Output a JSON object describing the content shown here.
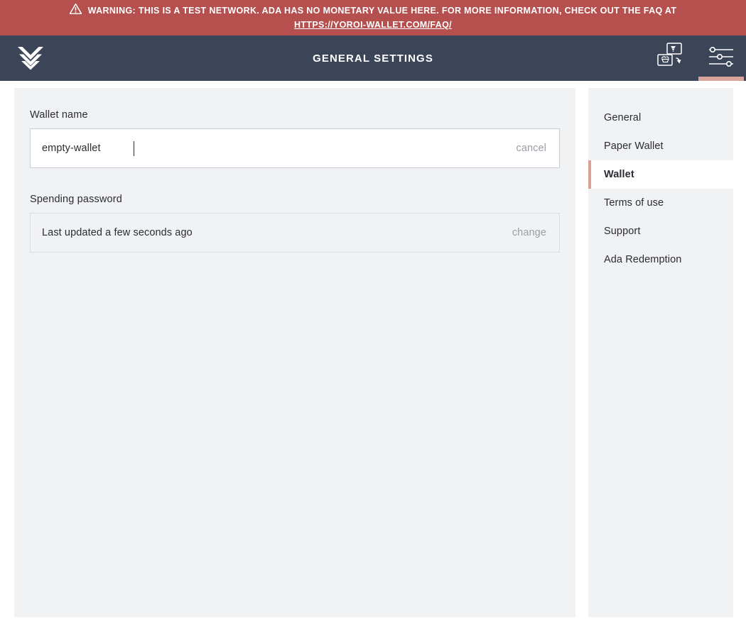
{
  "warning": {
    "icon": "warning-triangle-icon",
    "message": "WARNING: THIS IS A TEST NETWORK. ADA HAS NO MONETARY VALUE HERE. FOR MORE INFORMATION, CHECK OUT THE FAQ AT",
    "link_text": "HTTPS://YOROI-WALLET.COM/FAQ/",
    "background_color": "#b5504f",
    "text_color": "#ffffff"
  },
  "navbar": {
    "logo_name": "yoroi-logo",
    "title": "GENERAL SETTINGS",
    "background_color": "#3c4557",
    "active_indicator_color": "#daa49a",
    "actions": [
      {
        "name": "wallet-switch-icon",
        "label": "Switch wallet",
        "active": false
      },
      {
        "name": "settings-sliders-icon",
        "label": "Settings",
        "active": true
      }
    ]
  },
  "settings": {
    "wallet_name": {
      "label": "Wallet name",
      "value": "empty-wallet",
      "placeholder": "Wallet name",
      "action_label": "cancel",
      "focused": true
    },
    "spending_password": {
      "label": "Spending password",
      "value": "Last updated a few seconds ago",
      "action_label": "change"
    }
  },
  "menu": {
    "items": [
      {
        "label": "General",
        "active": false
      },
      {
        "label": "Paper Wallet",
        "active": false
      },
      {
        "label": "Wallet",
        "active": true
      },
      {
        "label": "Terms of use",
        "active": false
      },
      {
        "label": "Support",
        "active": false
      },
      {
        "label": "Ada Redemption",
        "active": false
      }
    ],
    "active_border_color": "#d9a297"
  }
}
